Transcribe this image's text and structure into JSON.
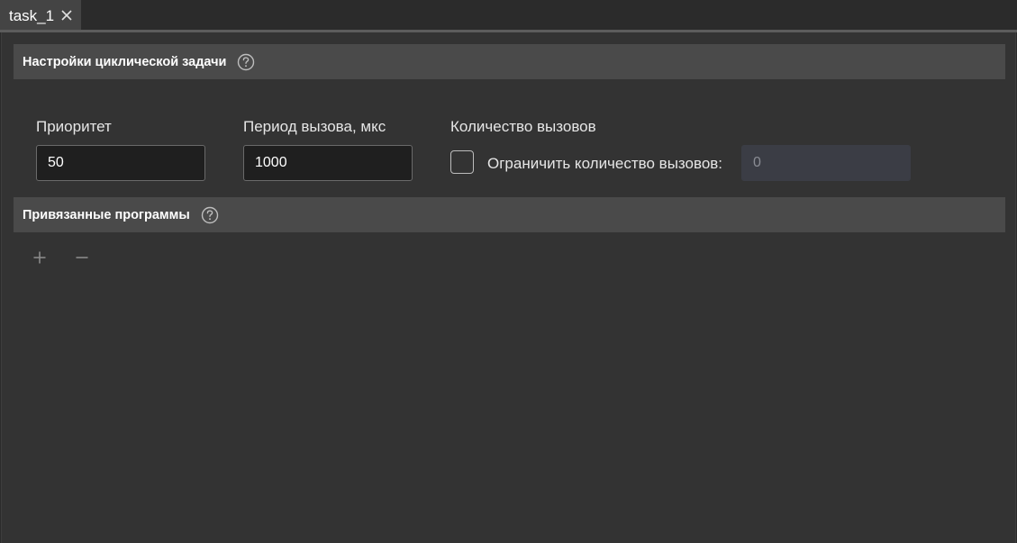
{
  "tabs": [
    {
      "label": "task_1",
      "active": true
    }
  ],
  "settings_section": {
    "title": "Настройки циклической задачи"
  },
  "fields": {
    "priority": {
      "label": "Приоритет",
      "value": "50"
    },
    "period": {
      "label": "Период вызова, мкс",
      "value": "1000"
    },
    "call_count": {
      "label": "Количество вызовов",
      "limit_label": "Ограничить количество вызовов:",
      "limit_checked": false,
      "limit_value": "0"
    }
  },
  "programs_section": {
    "title": "Привязанные программы"
  },
  "toolbar": {
    "add_icon": "plus-icon",
    "remove_icon": "minus-icon"
  },
  "colors": {
    "background": "#333333",
    "header_bg": "#4a4a4a",
    "tab_bg": "#444444",
    "input_bg": "#1f1f1f",
    "disabled_input_bg": "#3b3d45"
  }
}
